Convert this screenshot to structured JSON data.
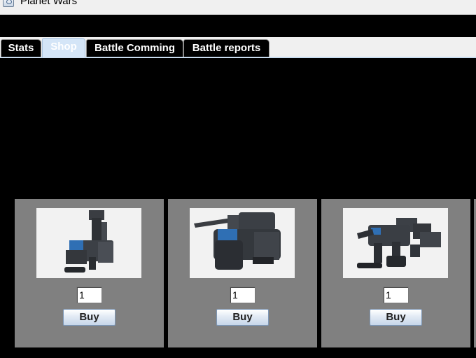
{
  "window": {
    "title": "Planet Wars"
  },
  "tabs": [
    {
      "label": "Stats"
    },
    {
      "label": "Shop"
    },
    {
      "label": "Battle Comming"
    },
    {
      "label": "Battle reports"
    }
  ],
  "active_tab": "Shop",
  "shop": {
    "items": [
      {
        "quantity": "1",
        "buy_label": "Buy",
        "image": "mech-walker-tall-icon"
      },
      {
        "quantity": "1",
        "buy_label": "Buy",
        "image": "mech-heavy-tank-icon"
      },
      {
        "quantity": "1",
        "buy_label": "Buy",
        "image": "mech-quad-walker-icon"
      }
    ]
  },
  "colors": {
    "card_bg": "#808080",
    "tab_bg": "#000000",
    "active_tab_bg": "#d4e5f7",
    "accent_blue": "#3b6fb0"
  }
}
